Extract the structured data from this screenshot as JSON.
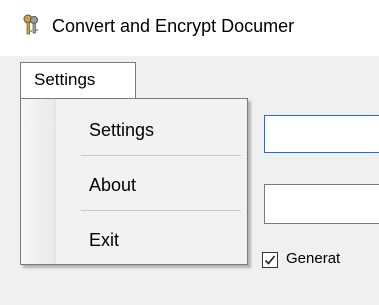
{
  "window": {
    "title": "Convert and Encrypt Documer",
    "icon": "keys-icon"
  },
  "menubar": {
    "settings_label": "Settings"
  },
  "dropdown": {
    "items": [
      {
        "label": "Settings"
      },
      {
        "label": "About"
      },
      {
        "label": "Exit"
      }
    ]
  },
  "form": {
    "field1_value": "",
    "field2_value": "",
    "checkbox_label": "Generat",
    "checkbox_checked": true
  },
  "colors": {
    "focus_border": "#1e6fd4",
    "menu_background": "#f2f2f2"
  }
}
